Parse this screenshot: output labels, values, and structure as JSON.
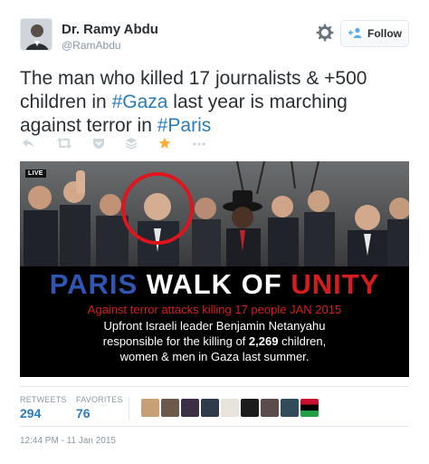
{
  "user": {
    "name": "Dr. Ramy Abdu",
    "handle": "@RamAbdu",
    "follow_label": "Follow"
  },
  "tweet": {
    "text_part1": "The man who killed 17 journalists & +500 children in ",
    "hashtag1": "#Gaza",
    "text_part2": " last year is marching against terror in ",
    "hashtag2": "#Paris"
  },
  "photo": {
    "live_label": "LIVE",
    "title_word1": "PARIS",
    "title_word2": "WALK OF",
    "title_word3": "UNITY",
    "subtitle": "Against terror attacks killing 17 people JAN 2015",
    "body_line1": "Upfront Israeli leader Benjamin Netanyahu",
    "body_line2_pre": "responsible for the killing of ",
    "body_line2_num": "2,269",
    "body_line2_post": " children,",
    "body_line3": "women & men in Gaza last summer."
  },
  "stats": {
    "retweets_label": "RETWEETS",
    "retweets_value": "294",
    "favorites_label": "FAVORITES",
    "favorites_value": "76"
  },
  "timestamp": "12:44 PM - 11 Jan 2015",
  "icons": [
    "reply-icon",
    "retweet-icon",
    "pocket-icon",
    "stack-icon",
    "favorite-star-icon",
    "more-icon",
    "gear-icon",
    "follow-person-icon"
  ],
  "colors": {
    "link": "#2b7bb9",
    "star": "#ffac33",
    "banner_blue": "#2f56b2",
    "banner_red": "#d51d1f"
  }
}
